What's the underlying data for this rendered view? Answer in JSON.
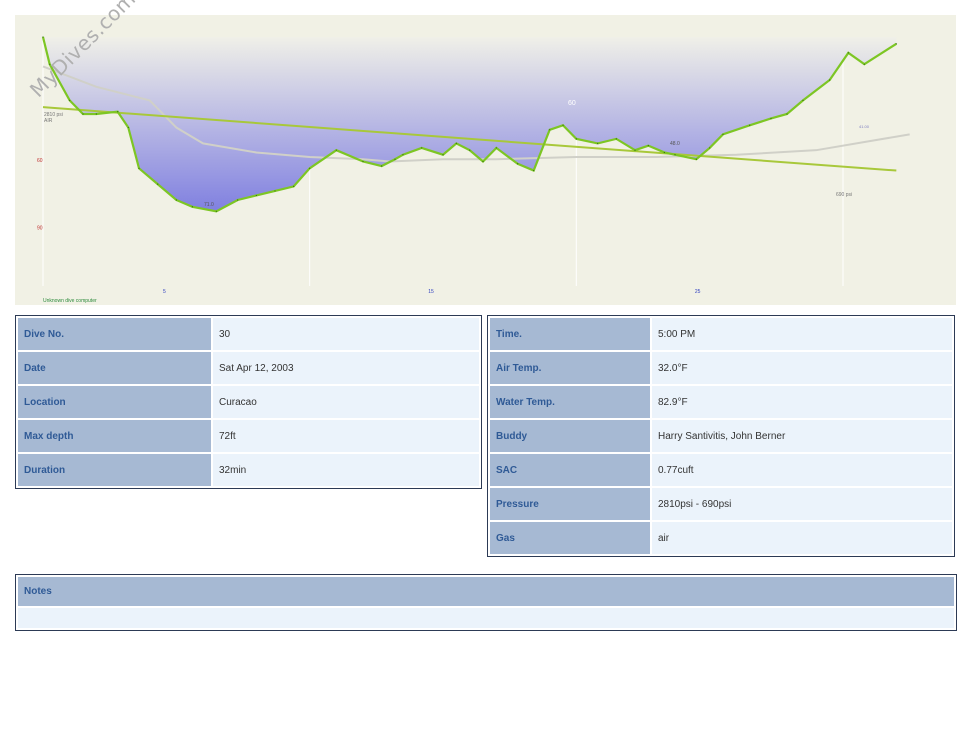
{
  "watermark": "MyDives.com",
  "chart_data": {
    "type": "line",
    "x_unit": "min",
    "xlim": [
      0,
      33
    ],
    "ylim": [
      0,
      110
    ],
    "x_ticks": [
      5,
      15,
      25
    ],
    "x_tick_labels": [
      "5",
      "15",
      "25"
    ],
    "y_ticks": [
      60,
      90
    ],
    "y_tick_labels": [
      "60",
      "90"
    ],
    "computer_label": "Unknown dive computer",
    "series": [
      {
        "role": "depth",
        "x": [
          0,
          0.25,
          1,
          1.5,
          2,
          2.8,
          3.2,
          3.6,
          4.3,
          5,
          5.6,
          6.5,
          7.3,
          8,
          8.7,
          9.4,
          10,
          11,
          12,
          12.7,
          13.2,
          13.5,
          14.2,
          15,
          15.5,
          16,
          16.5,
          17,
          17.8,
          18.4,
          19,
          19.5,
          20,
          20.8,
          21.5,
          22.2,
          22.7,
          23.3,
          23.7,
          24.5,
          25,
          25.5,
          26.5,
          27.3,
          27.9,
          28.5,
          29.5,
          30.2,
          30.8,
          32
        ],
        "y": [
          0,
          12,
          28,
          34,
          34,
          33,
          40,
          58,
          65,
          72,
          75,
          77,
          72,
          70,
          68,
          66,
          58,
          50,
          55,
          57,
          54,
          52,
          49,
          52,
          47,
          50,
          55,
          49,
          56,
          59,
          41,
          39,
          45,
          47,
          45,
          50,
          48,
          51,
          52,
          54,
          49,
          43,
          39,
          36,
          34,
          28,
          19,
          7,
          12,
          3
        ]
      },
      {
        "role": "ascent_rate",
        "x": [
          0,
          2,
          4,
          5,
          6,
          8,
          10,
          12,
          13,
          15,
          17,
          20,
          23,
          26,
          29,
          31,
          32.5
        ],
        "y": [
          13,
          22,
          28,
          40,
          47,
          51,
          53,
          54,
          55,
          54,
          54,
          53,
          53,
          52,
          50,
          46,
          43
        ]
      },
      {
        "role": "pressure",
        "unit": "psi",
        "start_label": "2810 psi",
        "end_label": "690 psi",
        "x": [
          0,
          32
        ],
        "y": [
          2810,
          690
        ]
      }
    ],
    "annotations": [
      {
        "label": "AIR"
      },
      {
        "label": "60"
      },
      {
        "label": "48.0"
      },
      {
        "label": "71.0"
      },
      {
        "label": "41.00"
      }
    ]
  },
  "left_table": [
    {
      "key": "Dive No.",
      "value": "30"
    },
    {
      "key": "Date",
      "value": "Sat Apr 12, 2003"
    },
    {
      "key": "Location",
      "value": "Curacao"
    },
    {
      "key": "Max depth",
      "value": "72ft"
    },
    {
      "key": "Duration",
      "value": "32min"
    }
  ],
  "right_table": [
    {
      "key": "Time.",
      "value": "5:00 PM"
    },
    {
      "key": "Air Temp.",
      "value": "32.0°F"
    },
    {
      "key": "Water Temp.",
      "value": "82.9°F"
    },
    {
      "key": "Buddy",
      "value": "Harry Santivitis, John Berner"
    },
    {
      "key": "SAC",
      "value": "0.77cuft"
    },
    {
      "key": "Pressure",
      "value": "2810psi - 690psi"
    },
    {
      "key": "Gas",
      "value": "air"
    }
  ],
  "notes": {
    "label": "Notes",
    "text": ""
  },
  "colors": {
    "depth_line": "#7dc624",
    "depth_fill_top": "#f0f0e8",
    "depth_fill_bottom": "#8080e0",
    "pressure_line": "#a8c83a",
    "ascent_line": "#d0d0c8",
    "label_bg": "#a6b9d3",
    "value_bg": "#ebf3fb",
    "label_text": "#2f5a96"
  }
}
